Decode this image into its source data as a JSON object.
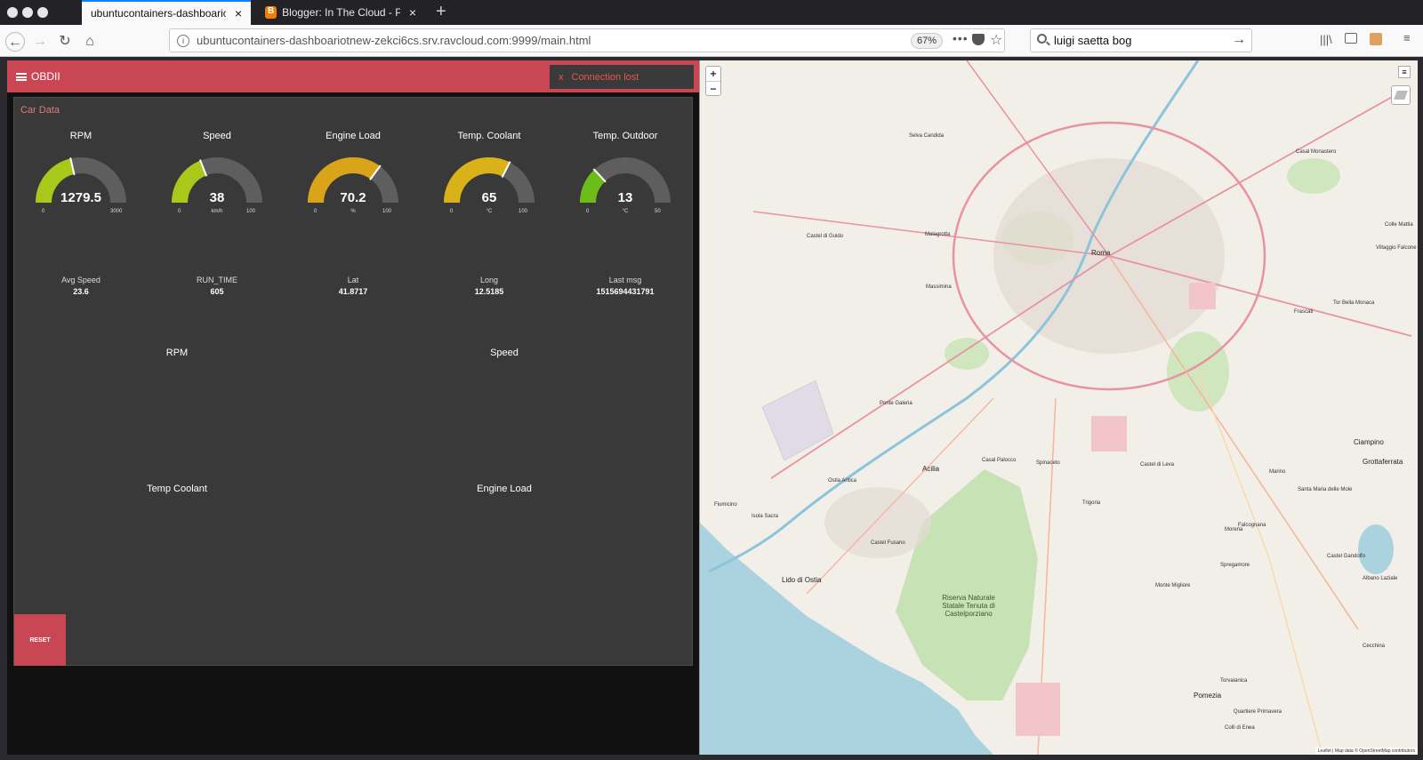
{
  "browser": {
    "tabs": [
      {
        "title": "ubuntucontainers-dashboariotnew-",
        "active": true
      },
      {
        "title": "Blogger: In The Cloud - Panoram",
        "active": false
      }
    ],
    "url": "ubuntucontainers-dashboariotnew-zekci6cs.srv.ravcloud.com:9999/main.html",
    "zoom": "67%",
    "search": "luigi saetta bog"
  },
  "app": {
    "title": "OBDII",
    "connection_status": "Connection lost",
    "card_title": "Car Data",
    "reset_label": "RESET"
  },
  "gauges": [
    {
      "label": "RPM",
      "value": "1279.5",
      "min": "0",
      "max": "3000",
      "unit": "",
      "fraction": 0.4265,
      "color": "#a8c81a"
    },
    {
      "label": "Speed",
      "value": "38",
      "min": "0",
      "max": "100",
      "unit": "km/h",
      "fraction": 0.38,
      "color": "#a8c81a"
    },
    {
      "label": "Engine Load",
      "value": "70.2",
      "min": "0",
      "max": "100",
      "unit": "%",
      "fraction": 0.702,
      "color": "#d9a41a"
    },
    {
      "label": "Temp. Coolant",
      "value": "65",
      "min": "0",
      "max": "100",
      "unit": "°C",
      "fraction": 0.65,
      "color": "#d9b21a"
    },
    {
      "label": "Temp. Outdoor",
      "value": "13",
      "min": "0",
      "max": "50",
      "unit": "°C",
      "fraction": 0.26,
      "color": "#6cbd1a"
    }
  ],
  "stats": [
    {
      "label": "Avg Speed",
      "value": "23.6"
    },
    {
      "label": "RUN_TIME",
      "value": "605"
    },
    {
      "label": "Lat",
      "value": "41.8717"
    },
    {
      "label": "Long",
      "value": "12.5185"
    },
    {
      "label": "Last msg",
      "value": "1515694431791"
    }
  ],
  "charts": [
    "RPM",
    "Speed",
    "Temp Coolant",
    "Engine Load"
  ],
  "map": {
    "zoom_in": "+",
    "zoom_out": "−",
    "attribution": "Leaflet | Map data © OpenStreetMap contributors",
    "labels": [
      "Roma",
      "Acilia",
      "Fiumicino",
      "Lido di Ostia",
      "Ciampino",
      "Pomezia",
      "Riserva Naturale Statale Tenuta di Castelporziano",
      "Grottaferrata",
      "Castel Gandolfo",
      "Albano Laziale",
      "Marino",
      "Frascati",
      "Tor Bella Monaca",
      "Isola Sacra",
      "Ostia Antica",
      "Castel Fusano",
      "Spinaceto",
      "Trigoria",
      "Castel di Leva",
      "Santa Maria delle Mole",
      "Morena",
      "Casal Palocco",
      "Ponte Galeria",
      "Castel di Guido",
      "Malagrotta",
      "Massimina",
      "Selva Candida",
      "Casal Monastero",
      "Colle Mattia",
      "Villaggio Falcone",
      "Monte Migliore",
      "Spregamore",
      "Falcognana",
      "Quartiere Primavera",
      "Cecchina",
      "Colli di Enea",
      "Torvaianica"
    ]
  }
}
